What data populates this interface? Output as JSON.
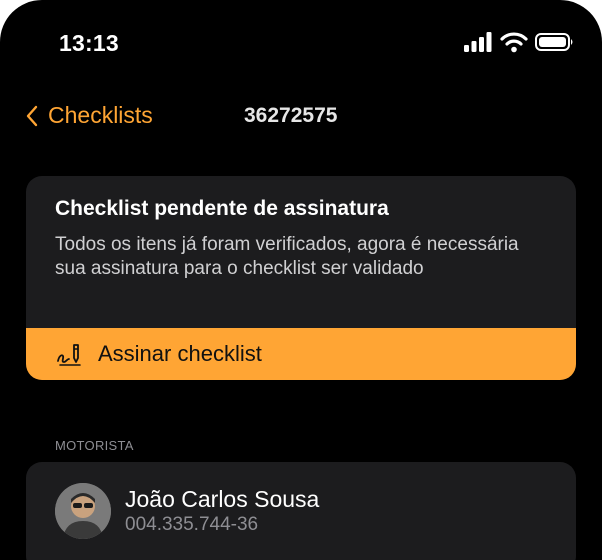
{
  "status_bar": {
    "time": "13:13",
    "icons": [
      "cellular-signal-icon",
      "wifi-icon",
      "battery-icon"
    ]
  },
  "nav": {
    "back_label": "Checklists",
    "title": "36272575"
  },
  "pending_card": {
    "title": "Checklist pendente de assinatura",
    "description": "Todos os itens já foram verificados, agora é necessária sua assinatura para o checklist ser validado",
    "button_label": "Assinar checklist",
    "button_icon": "signature-icon"
  },
  "driver_section": {
    "label": "MOTORISTA",
    "name": "João Carlos Sousa",
    "document": "004.335.744-36"
  },
  "colors": {
    "accent": "#FFA534",
    "background": "#000000",
    "card": "#1C1C1E"
  }
}
